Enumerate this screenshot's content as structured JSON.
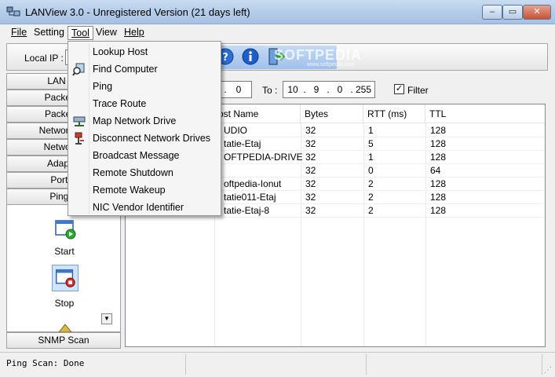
{
  "window": {
    "title": "LANView 3.0 - Unregistered Version (21 days left)",
    "min_glyph": "–",
    "max_glyph": "▭",
    "close_glyph": "✕"
  },
  "menubar": [
    {
      "label": "File"
    },
    {
      "label": "Setting"
    },
    {
      "label": "Tool",
      "active": true
    },
    {
      "label": "View"
    },
    {
      "label": "Help"
    }
  ],
  "toolbar": {
    "local_ip_label": "Local IP :",
    "watermark": "SOFTPEDIA",
    "watermark_sub": "www.softpedia.com",
    "icons": [
      "help-icon",
      "info-icon",
      "exit-icon"
    ]
  },
  "left_panel": {
    "items": [
      "LAN Se",
      "Packet C",
      "Packet S",
      "Network Co",
      "Network I",
      "Adapter",
      "Port S",
      "Ping S"
    ],
    "start_label": "Start",
    "stop_label": "Stop",
    "snmp_label": "SNMP Scan",
    "scroll_glyph": "▼"
  },
  "range": {
    "from": {
      "seg3": "0"
    },
    "to_label": "To :",
    "to": {
      "seg1": "10",
      "seg2": "9",
      "seg3": "0",
      "seg4": "255"
    },
    "filter_label": "Filter",
    "filter_checked": true,
    "check_glyph": "✓"
  },
  "table": {
    "columns": [
      "ost Name",
      "Bytes",
      "RTT (ms)",
      "TTL"
    ],
    "rows": [
      {
        "host": "UDIO",
        "bytes": "32",
        "rtt": "1",
        "ttl": "128"
      },
      {
        "host": "tatie-Etaj",
        "bytes": "32",
        "rtt": "5",
        "ttl": "128"
      },
      {
        "host": "OFTPEDIA-DRIVE",
        "bytes": "32",
        "rtt": "1",
        "ttl": "128"
      },
      {
        "host": "",
        "bytes": "32",
        "rtt": "0",
        "ttl": "64"
      },
      {
        "host": "oftpedia-Ionut",
        "bytes": "32",
        "rtt": "2",
        "ttl": "128"
      },
      {
        "host": "tatie011-Etaj",
        "bytes": "32",
        "rtt": "2",
        "ttl": "128"
      },
      {
        "host": "tatie-Etaj-8",
        "bytes": "32",
        "rtt": "2",
        "ttl": "128"
      }
    ]
  },
  "tool_menu": [
    {
      "label": "Lookup Host",
      "icon": ""
    },
    {
      "label": "Find Computer",
      "icon": "find-computer-icon"
    },
    {
      "label": "Ping",
      "icon": ""
    },
    {
      "label": "Trace Route",
      "icon": ""
    },
    {
      "label": "Map Network Drive",
      "icon": "map-drive-icon"
    },
    {
      "label": "Disconnect Network Drives",
      "icon": "disconnect-drive-icon"
    },
    {
      "label": "Broadcast Message",
      "icon": ""
    },
    {
      "label": "Remote Shutdown",
      "icon": ""
    },
    {
      "label": "Remote Wakeup",
      "icon": ""
    },
    {
      "label": "NIC Vendor Identifier",
      "icon": ""
    }
  ],
  "status": {
    "text": "Ping Scan: Done",
    "grip_glyph": "⋰"
  }
}
